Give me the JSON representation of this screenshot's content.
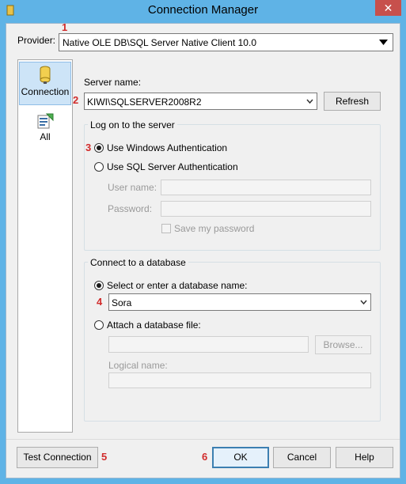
{
  "window": {
    "title": "Connection Manager",
    "close_glyph": "✕",
    "accent_color": "#5fb3e6",
    "close_color": "#c7504c"
  },
  "callouts": [
    "1",
    "2",
    "3",
    "4",
    "5",
    "6"
  ],
  "provider": {
    "label": "Provider:",
    "value": "Native OLE DB\\SQL Server Native Client 10.0"
  },
  "sidebar": {
    "items": [
      {
        "label": "Connection",
        "icon": "database-icon",
        "selected": true
      },
      {
        "label": "All",
        "icon": "properties-icon",
        "selected": false
      }
    ]
  },
  "server": {
    "label": "Server name:",
    "value": "KIWI\\SQLSERVER2008R2",
    "refresh_label": "Refresh"
  },
  "logon": {
    "group_title": "Log on to the server",
    "windows_auth": "Use Windows Authentication",
    "sql_auth": "Use SQL Server Authentication",
    "selected": "windows",
    "user_name_label": "User name:",
    "password_label": "Password:",
    "save_password_label": "Save my password"
  },
  "database": {
    "group_title": "Connect to a database",
    "select_option": "Select or enter a database name:",
    "selected_db": "Sora",
    "attach_option": "Attach a database file:",
    "browse_label": "Browse...",
    "logical_name_label": "Logical name:",
    "selected": "select"
  },
  "footer": {
    "test_connection": "Test Connection",
    "ok": "OK",
    "cancel": "Cancel",
    "help": "Help"
  }
}
